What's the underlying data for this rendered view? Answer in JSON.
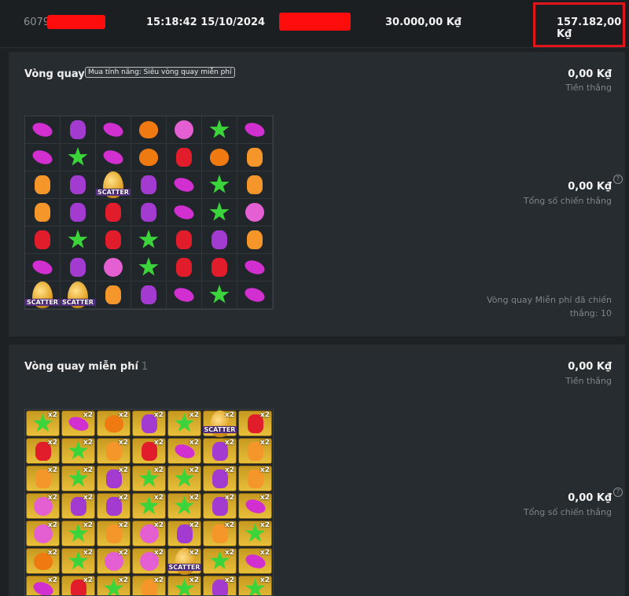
{
  "top_bar": {
    "id_text": "6079",
    "time": "15:18:42 15/10/2024",
    "bet": "30.000,00 K₫",
    "win": "157.182,00 K₫",
    "highlight_color": "#e1161b",
    "redaction_color": "#ff0d0d"
  },
  "spin_panel": {
    "title": "Vòng quay",
    "feature_tag": "Mua tính năng: Siêu vòng quay miễn phí",
    "win_value": "0,00 K₫",
    "win_label": "Tiền thắng",
    "total_value": "0,00 K₫",
    "total_label": "Tổng số chiến thắng",
    "free_spins_label": "Vòng quay Miễn phí đã chiến thắng: 10",
    "grid": [
      [
        "candy-magenta",
        "bear-purple",
        "candy-magenta",
        "heart-orange",
        "ball-pink",
        "star-green",
        "candy-magenta"
      ],
      [
        "candy-magenta",
        "star-green",
        "candy-magenta",
        "heart-orange",
        "bear-red",
        "heart-orange",
        "bear-orange"
      ],
      [
        "bear-orange",
        "bear-purple",
        "scatter",
        "bear-purple",
        "candy-magenta",
        "star-green",
        "bear-orange"
      ],
      [
        "bear-orange",
        "bear-purple",
        "bear-red",
        "bear-purple",
        "candy-magenta",
        "star-green",
        "ball-pink"
      ],
      [
        "bear-red",
        "star-green",
        "bear-red",
        "star-green",
        "bear-red",
        "bear-purple",
        "bear-orange"
      ],
      [
        "candy-magenta",
        "bear-purple",
        "ball-pink",
        "star-green",
        "bear-red",
        "bear-red",
        "candy-magenta"
      ],
      [
        "scatter",
        "scatter",
        "bear-orange",
        "bear-purple",
        "candy-magenta",
        "star-green",
        "candy-magenta"
      ]
    ],
    "scatter_label": "SCATTER"
  },
  "free_spin_panel": {
    "title": "Vòng quay miễn phí",
    "count": "1",
    "win_value": "0,00 K₫",
    "win_label": "Tiền thắng",
    "total_value": "0,00 K₫",
    "total_label": "Tổng số chiến thắng",
    "multiplier_label": "x2",
    "grid": [
      [
        "star-green",
        "candy-magenta",
        "heart-orange",
        "bear-purple",
        "star-green",
        "scatter",
        "bear-red"
      ],
      [
        "bear-red",
        "star-green",
        "bear-orange",
        "bear-red",
        "candy-magenta",
        "bear-purple",
        "bear-orange"
      ],
      [
        "bear-orange",
        "star-green",
        "bear-purple",
        "star-green",
        "star-green",
        "bear-purple",
        "bear-orange"
      ],
      [
        "ball-pink",
        "bear-purple",
        "bear-purple",
        "star-green",
        "star-green",
        "bear-purple",
        "candy-magenta"
      ],
      [
        "ball-pink",
        "star-green",
        "bear-orange",
        "ball-pink",
        "bear-purple",
        "bear-orange",
        "star-green"
      ],
      [
        "heart-orange",
        "star-green",
        "ball-pink",
        "ball-pink",
        "scatter",
        "star-green",
        "candy-magenta"
      ],
      [
        "candy-magenta",
        "bear-red",
        "star-green",
        "bear-orange",
        "star-green",
        "bear-purple",
        "star-green"
      ]
    ],
    "scatter_label": "SCATTER"
  },
  "symbol_colors": {
    "candy-magenta": "#d22fd0",
    "bear-purple": "#a33bd1",
    "heart-orange": "#f07a12",
    "ball-pink": "#e45fd2",
    "star-green": "#3bd43b",
    "bear-red": "#e11d2c",
    "bear-orange": "#f5962a"
  }
}
